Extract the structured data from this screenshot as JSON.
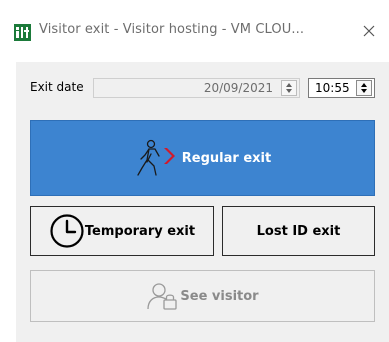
{
  "window": {
    "title": "Visitor exit - Visitor hosting - VM CLOU...",
    "icon": "app-logo-icon",
    "close_icon": "close-icon"
  },
  "form": {
    "exit_date_label": "Exit date",
    "exit_date_value": "20/09/2021",
    "exit_time_value": "10:55"
  },
  "buttons": {
    "regular_exit": {
      "label": "Regular exit",
      "icon": "walking-person-arrow-icon"
    },
    "temporary_exit": {
      "label": "Temporary exit",
      "icon": "clock-icon"
    },
    "lost_id_exit": {
      "label": "Lost ID exit"
    },
    "see_visitor": {
      "label": "See visitor",
      "icon": "visitor-lock-icon",
      "enabled": false
    }
  },
  "colors": {
    "primary_button": "#3d84d0",
    "panel_background": "#f0f0f0",
    "arrow_accent": "#d11a2a"
  }
}
